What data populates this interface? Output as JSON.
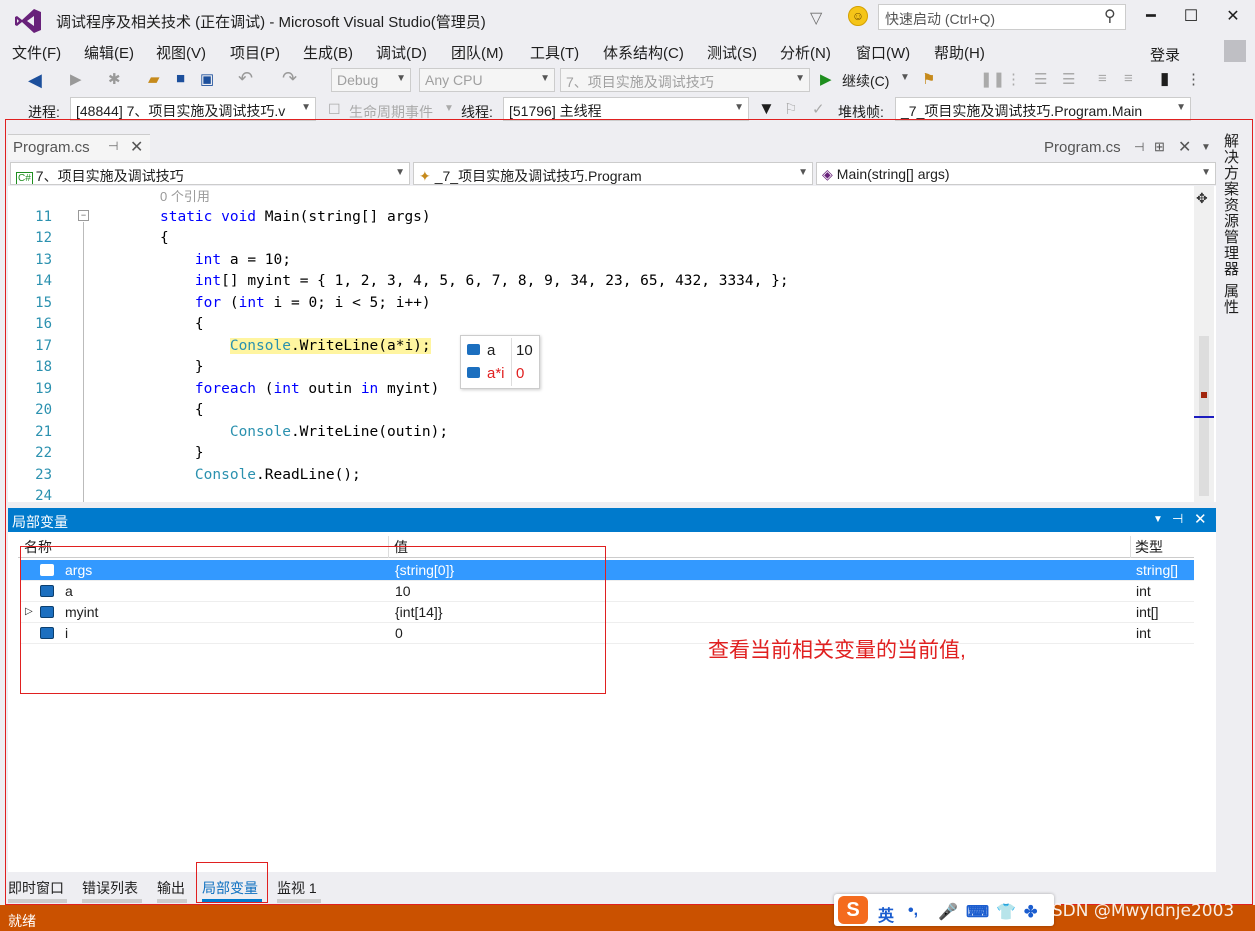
{
  "window": {
    "title": "调试程序及相关技术 (正在调试) - Microsoft Visual Studio(管理员)",
    "quick_launch_placeholder": "快速启动 (Ctrl+Q)",
    "login": "登录"
  },
  "menu": [
    "文件(F)",
    "编辑(E)",
    "视图(V)",
    "项目(P)",
    "生成(B)",
    "调试(D)",
    "团队(M)",
    "工具(T)",
    "体系结构(C)",
    "测试(S)",
    "分析(N)",
    "窗口(W)",
    "帮助(H)"
  ],
  "toolbar": {
    "config": "Debug",
    "platform": "Any CPU",
    "startup_project": "7、项目实施及调试技巧",
    "continue_label": "继续(C)"
  },
  "debug_location": {
    "process_label": "进程:",
    "process_value": "[48844] 7、项目实施及调试技巧.v",
    "lifecycle_label": "生命周期事件",
    "thread_label": "线程:",
    "thread_value": "[51796] 主线程",
    "stack_label": "堆栈帧:",
    "stack_value": "_7_项目实施及调试技巧.Program.Main"
  },
  "doc_tab": {
    "label": "Program.cs",
    "preview_label": "Program.cs"
  },
  "side_tabs": {
    "solution": "解决方案资源管理器",
    "properties": "属性"
  },
  "navbar": {
    "project": "7、项目实施及调试技巧",
    "class": "_7_项目实施及调试技巧.Program",
    "member": "Main(string[] args)"
  },
  "editor": {
    "codelens": "0 个引用",
    "line_numbers": [
      "11",
      "12",
      "13",
      "14",
      "15",
      "16",
      "17",
      "18",
      "19",
      "20",
      "21",
      "22",
      "23",
      "24"
    ]
  },
  "datatip": [
    {
      "name": "a",
      "value": "10"
    },
    {
      "name": "a*i",
      "value": "0"
    }
  ],
  "locals": {
    "title": "局部变量",
    "columns": [
      "名称",
      "值",
      "类型"
    ],
    "rows": [
      {
        "name": "args",
        "value": "{string[0]}",
        "type": "string[]"
      },
      {
        "name": "a",
        "value": "10",
        "type": "int"
      },
      {
        "name": "myint",
        "value": "{int[14]}",
        "type": "int[]"
      },
      {
        "name": "i",
        "value": "0",
        "type": "int"
      }
    ]
  },
  "annotation": "查看当前相关变量的当前值,",
  "bottom_tabs": [
    "即时窗口",
    "错误列表",
    "输出",
    "局部变量",
    "监视 1"
  ],
  "status": "就绪",
  "ime": {
    "lang": "英",
    "logo": "S"
  },
  "watermark": "CSDN @Mwyldnje2003"
}
